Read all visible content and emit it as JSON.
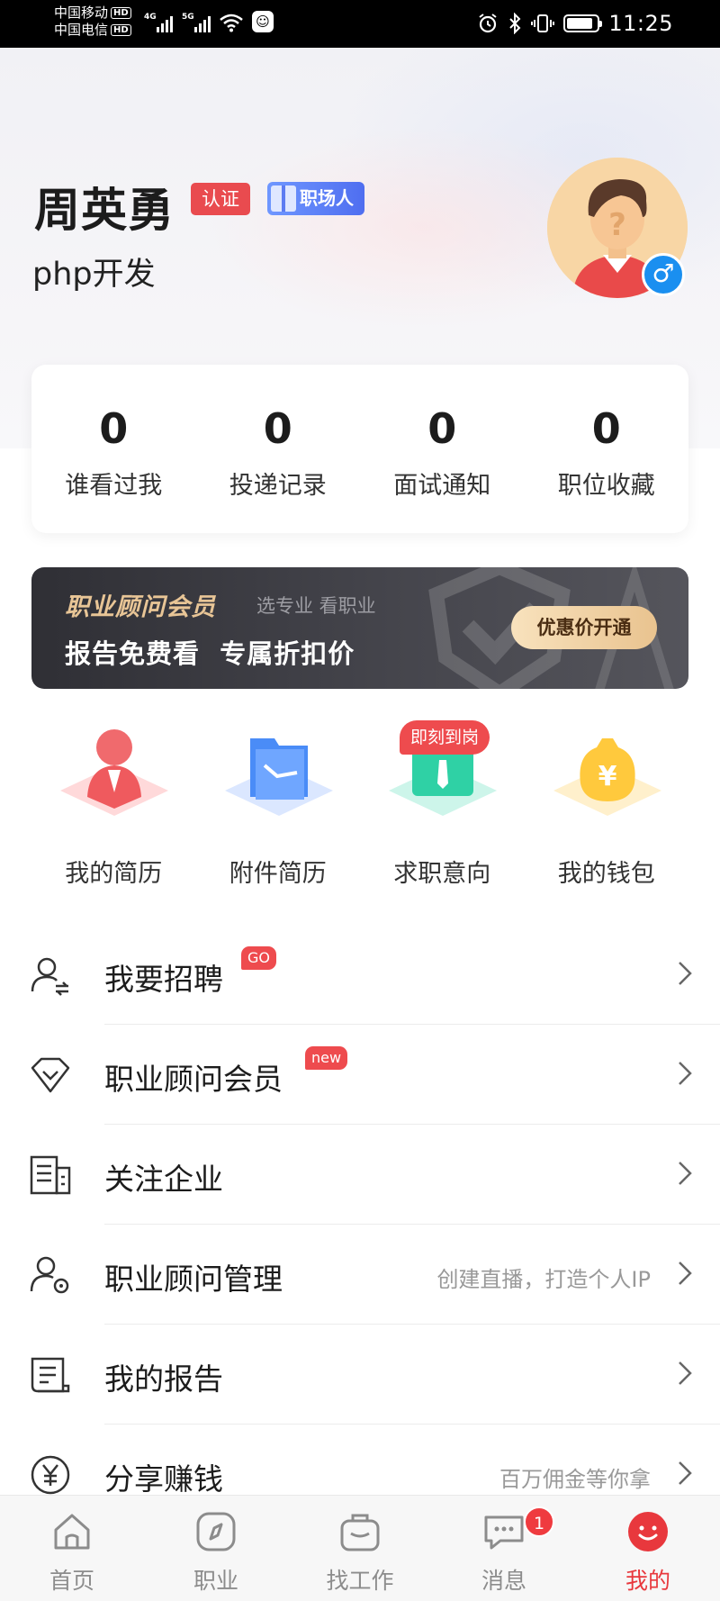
{
  "status_bar": {
    "carrier_1": "中国移动",
    "carrier_2": "中国电信",
    "hd": "HD",
    "net_1": "4G",
    "net_2": "5G",
    "time": "11:25",
    "icons": [
      "signal-icon",
      "wifi-icon",
      "qq-icon",
      "alarm-icon",
      "bluetooth-icon",
      "vibrate-icon",
      "battery-icon"
    ],
    "battery_level": 0.85
  },
  "profile": {
    "name": "周英勇",
    "cert_badge": "认证",
    "role_badge": "职场人",
    "job_title": "php开发",
    "gender_symbol": "♂"
  },
  "stats": [
    {
      "value": "0",
      "label": "谁看过我"
    },
    {
      "value": "0",
      "label": "投递记录"
    },
    {
      "value": "0",
      "label": "面试通知"
    },
    {
      "value": "0",
      "label": "职位收藏"
    }
  ],
  "vip_banner": {
    "title": "职业顾问会员",
    "subtitle": "选专业 看职业",
    "main": "报告免费看  专属折扣价",
    "button": "优惠价开通"
  },
  "quick_actions": [
    {
      "label": "我的简历",
      "icon": "resume-icon"
    },
    {
      "label": "附件简历",
      "icon": "folder-icon"
    },
    {
      "label": "求职意向",
      "icon": "job-intention-icon"
    },
    {
      "label": "我的钱包",
      "icon": "wallet-icon"
    }
  ],
  "quick_tag": "即刻到岗",
  "menu": [
    {
      "label": "我要招聘",
      "tag": "GO",
      "hint": "",
      "icon": "recruit-icon"
    },
    {
      "label": "职业顾问会员",
      "tag": "new",
      "hint": "",
      "icon": "diamond-icon"
    },
    {
      "label": "关注企业",
      "tag": "",
      "hint": "",
      "icon": "company-icon"
    },
    {
      "label": "职业顾问管理",
      "tag": "",
      "hint": "创建直播，打造个人IP",
      "icon": "user-settings-icon"
    },
    {
      "label": "我的报告",
      "tag": "",
      "hint": "",
      "icon": "report-icon"
    },
    {
      "label": "分享赚钱",
      "tag": "",
      "hint": "百万佣金等你拿",
      "icon": "yuan-icon"
    }
  ],
  "tabs": [
    {
      "label": "首页",
      "icon": "home-icon"
    },
    {
      "label": "职业",
      "icon": "compass-icon"
    },
    {
      "label": "找工作",
      "icon": "briefcase-icon"
    },
    {
      "label": "消息",
      "icon": "message-icon",
      "badge": "1"
    },
    {
      "label": "我的",
      "icon": "me-icon",
      "active": true
    }
  ],
  "colors": {
    "accent_red": "#e8383d",
    "vip_gold": "#e8c596",
    "badge_blue": "#4f6ef0"
  }
}
